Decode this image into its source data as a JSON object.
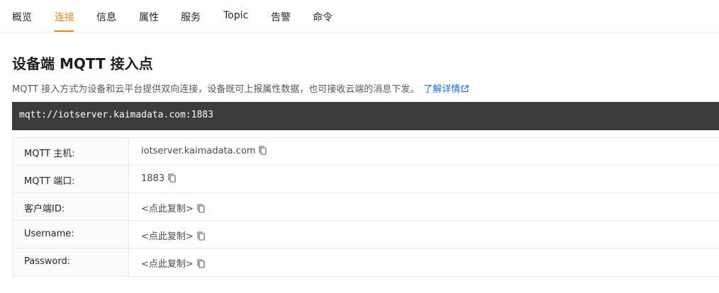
{
  "tabs": {
    "items": [
      {
        "label": "概览"
      },
      {
        "label": "连接",
        "active": true
      },
      {
        "label": "信息"
      },
      {
        "label": "属性"
      },
      {
        "label": "服务"
      },
      {
        "label": "Topic"
      },
      {
        "label": "告警"
      },
      {
        "label": "命令"
      }
    ],
    "active_color": "#d9861c"
  },
  "section": {
    "title": "设备端 MQTT 接入点",
    "description": "MQTT 接入方式为设备和云平台提供双向连接，设备既可上报属性数据，也可接收云端的消息下发。",
    "learn_more": "了解详情",
    "link_color": "#1769d4"
  },
  "endpoint": {
    "url": "mqtt://iotserver.kaimadata.com:1883"
  },
  "details": {
    "rows": [
      {
        "label": "MQTT 主机:",
        "value": "iotserver.kaimadata.com",
        "icon": "copy-icon"
      },
      {
        "label": "MQTT 端口:",
        "value": "1883",
        "icon": "copy-icon"
      },
      {
        "label": "客户端ID:",
        "value": "<点此复制>",
        "icon": "copy-icon"
      },
      {
        "label": "Username:",
        "value": "<点此复制>",
        "icon": "copy-icon"
      },
      {
        "label": "Password:",
        "value": "<点此复制>",
        "icon": "copy-icon"
      }
    ]
  }
}
